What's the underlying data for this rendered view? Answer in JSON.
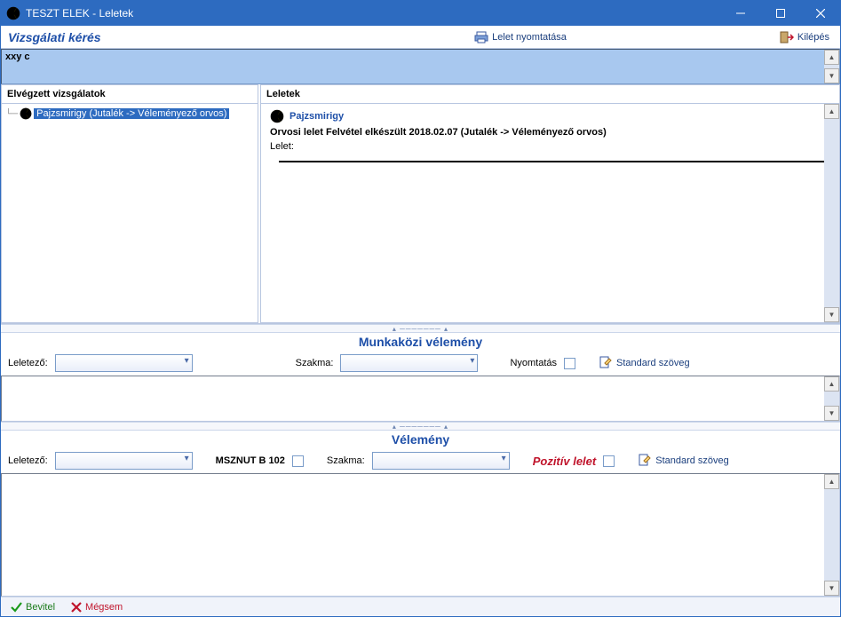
{
  "titlebar": {
    "text": "TESZT ELEK - Leletek"
  },
  "toolbar": {
    "title": "Vizsgálati kérés",
    "print_label": "Lelet nyomtatása",
    "exit_label": "Kilépés"
  },
  "request": {
    "text": "xxy c"
  },
  "left_panel": {
    "header": "Elvégzett vizsgálatok",
    "item_text": "Pajzsmirigy  (Jutalék -> Véleményező orvos)"
  },
  "right_panel": {
    "header": "Leletek",
    "title": "Pajzsmirigy",
    "meta": "Orvosi lelet    Felvétel elkészült 2018.02.07   (Jutalék -> Véleményező orvos)",
    "lelet_label": "Lelet:"
  },
  "section1": {
    "title": "Munkaközi vélemény",
    "leletezo_label": "Leletező:",
    "szakma_label": "Szakma:",
    "nyomtatas_label": "Nyomtatás",
    "standard_label": "Standard szöveg"
  },
  "section2": {
    "title": "Vélemény",
    "leletezo_label": "Leletező:",
    "mszn_label": "MSZNUT B 102",
    "szakma_label": "Szakma:",
    "pozitiv_label": "Pozitív lelet",
    "standard_label": "Standard szöveg"
  },
  "footer": {
    "bevitel_label": "Bevitel",
    "megsem_label": "Mégsem"
  }
}
